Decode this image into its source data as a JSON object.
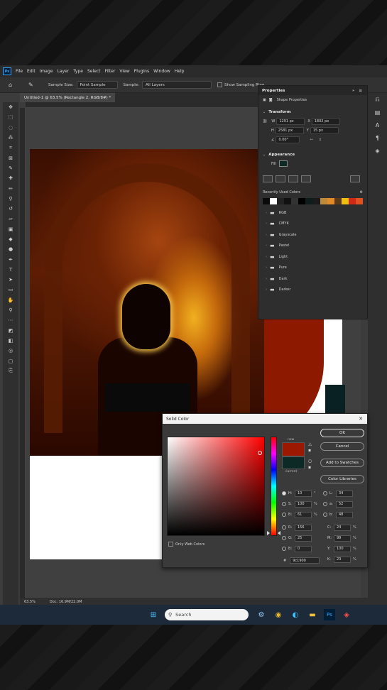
{
  "menu": [
    "File",
    "Edit",
    "Image",
    "Layer",
    "Type",
    "Select",
    "Filter",
    "View",
    "Plugins",
    "Window",
    "Help"
  ],
  "options_bar": {
    "sample_size_label": "Sample Size:",
    "sample_size_value": "Point Sample",
    "sample_label": "Sample:",
    "sample_value": "All Layers",
    "show_ring_label": "Show Sampling Ring"
  },
  "document_tab": "Untitled-1 @ 63.5% (Rectangle 2, RGB/8#) *",
  "properties": {
    "title": "Properties",
    "layer_type": "Shape Properties",
    "transform_title": "Transform",
    "w": "1291 px",
    "x": "1802 px",
    "h": "2581 px",
    "y": "15 px",
    "angle": "0.00°",
    "appearance_title": "Appearance",
    "recent_colors_title": "Recently Used Colors",
    "recent_colors": [
      "#0a0a0a",
      "#ffffff",
      "#222222",
      "#111111",
      "#333333",
      "#000000",
      "#0e1c1c",
      "#1a1a1a",
      "#bd8a3a",
      "#e08a2a",
      "#5a3a1a",
      "#f0c010",
      "#d02818",
      "#e05020"
    ],
    "folders": [
      "RGB",
      "CMYK",
      "Grayscale",
      "Pastel",
      "Light",
      "Pure",
      "Dark",
      "Darker"
    ]
  },
  "color_dialog": {
    "title": "Solid Color",
    "new_label": "new",
    "current_label": "current",
    "new_color": "#9c1900",
    "current_color": "#0d2a26",
    "ok": "OK",
    "cancel": "Cancel",
    "add_swatches": "Add to Swatches",
    "color_libraries": "Color Libraries",
    "only_web": "Only Web Colors",
    "h": "10",
    "s": "100",
    "b": "61",
    "r": "156",
    "g": "25",
    "bb": "0",
    "L": "34",
    "a": "52",
    "lb": "48",
    "c": "24",
    "m": "99",
    "y": "100",
    "k": "23",
    "hex_label": "#",
    "hex": "9c1900",
    "deg": "°",
    "pct": "%"
  },
  "status": {
    "zoom": "63.5%",
    "doc": "Doc: 16.9M/22.0M"
  },
  "taskbar": {
    "search_placeholder": "Search"
  }
}
